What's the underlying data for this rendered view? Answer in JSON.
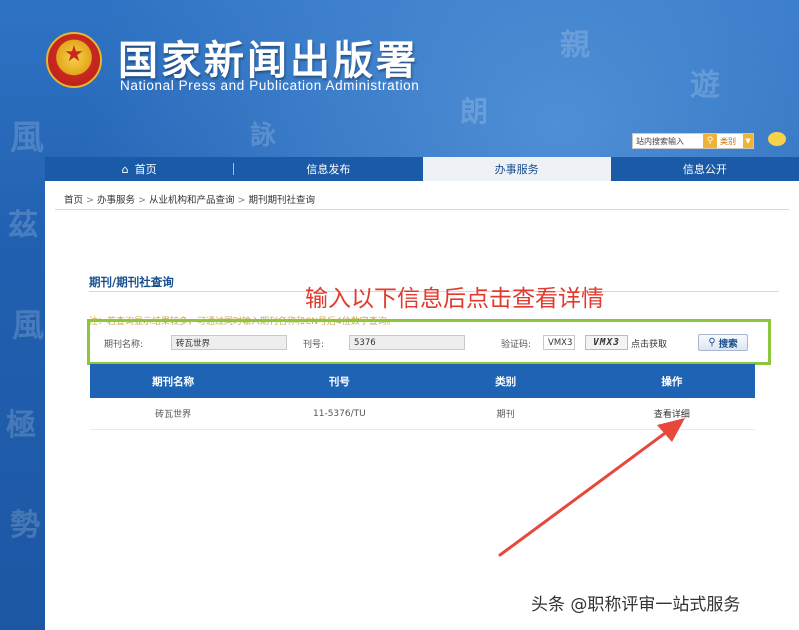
{
  "header": {
    "title": "国家新闻出版署",
    "subtitle": "National  Press  and  Publication  Administration",
    "search_placeholder": "站内搜索输入",
    "category_label": "类别"
  },
  "nav": {
    "items": [
      {
        "label": "首页",
        "icon": "home-icon"
      },
      {
        "label": "信息发布"
      },
      {
        "label": "办事服务",
        "active": true
      },
      {
        "label": "信息公开"
      }
    ]
  },
  "breadcrumb": [
    "首页",
    "办事服务",
    "从业机构和产品查询",
    "期刊期刊社查询"
  ],
  "section_title": "期刊/期刊社查询",
  "annotation": "输入以下信息后点击查看详情",
  "note": "注：若查询显示结果较多，可通过同时输入期刊名称和CN号后4位数字查询。",
  "form": {
    "name_label": "期刊名称:",
    "name_value": "砖瓦世界",
    "cn_label": "刊号:",
    "cn_value": "5376",
    "captcha_label": "验证码:",
    "captcha_value": "VMX3",
    "captcha_image_text": "VMX3",
    "captcha_refresh": "点击获取",
    "search_button": "搜索"
  },
  "table": {
    "headers": [
      "期刊名称",
      "刊号",
      "类别",
      "操作"
    ],
    "rows": [
      {
        "name": "砖瓦世界",
        "cn": "11-5376/TU",
        "category": "期刊",
        "action": "查看详细"
      }
    ]
  },
  "watermark": "头条 @职称评审一站式服务",
  "colors": {
    "background": "#1f5fae",
    "nav": "#1a5aa6",
    "table_header": "#1f63b4",
    "highlight_border": "#8cc63f",
    "annotation": "#e23a2f"
  }
}
